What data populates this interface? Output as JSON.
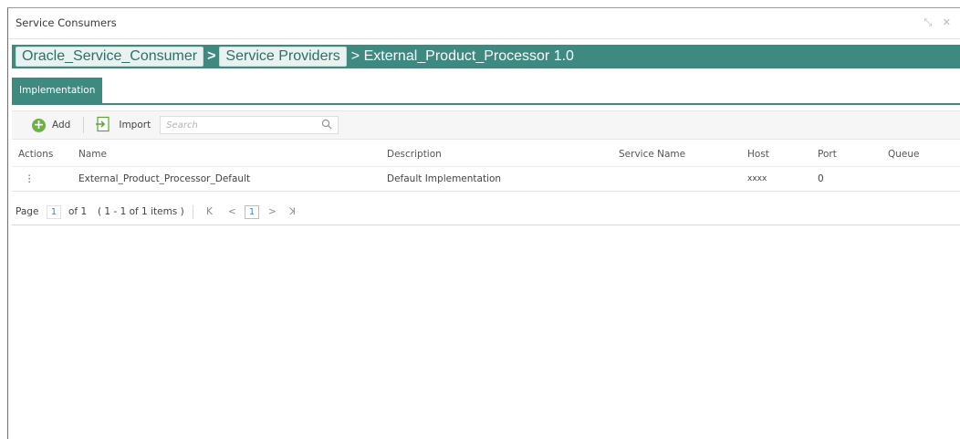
{
  "window": {
    "title": "Service Consumers",
    "controls": "⤡ ✕"
  },
  "breadcrumb": {
    "items": [
      "Oracle_Service_Consumer",
      "Service Providers"
    ],
    "separator": ">",
    "current": "> External_Product_Processor 1.0"
  },
  "tabs": [
    {
      "label": "Implementation",
      "active": true
    }
  ],
  "toolbar": {
    "add_label": "Add",
    "import_label": "Import",
    "search_placeholder": "Search"
  },
  "table": {
    "columns": [
      "Actions",
      "Name",
      "Description",
      "Service Name",
      "Host",
      "Port",
      "Queue"
    ],
    "rows": [
      {
        "actions": "⋮",
        "name": "External_Product_Processor_Default",
        "description": "Default Implementation",
        "service_name": "",
        "host": "xxxx",
        "port": "0",
        "queue": ""
      }
    ]
  },
  "pagination": {
    "page_label": "Page",
    "page_input": "1",
    "of_pages": "of 1",
    "items_info": "( 1 - 1 of 1 items )",
    "current_page": "1",
    "first": "K",
    "prev": "<",
    "next": ">",
    "last": "ꓘ"
  },
  "colors": {
    "accent": "#3f8a80",
    "add_icon": "#6ab43e"
  }
}
